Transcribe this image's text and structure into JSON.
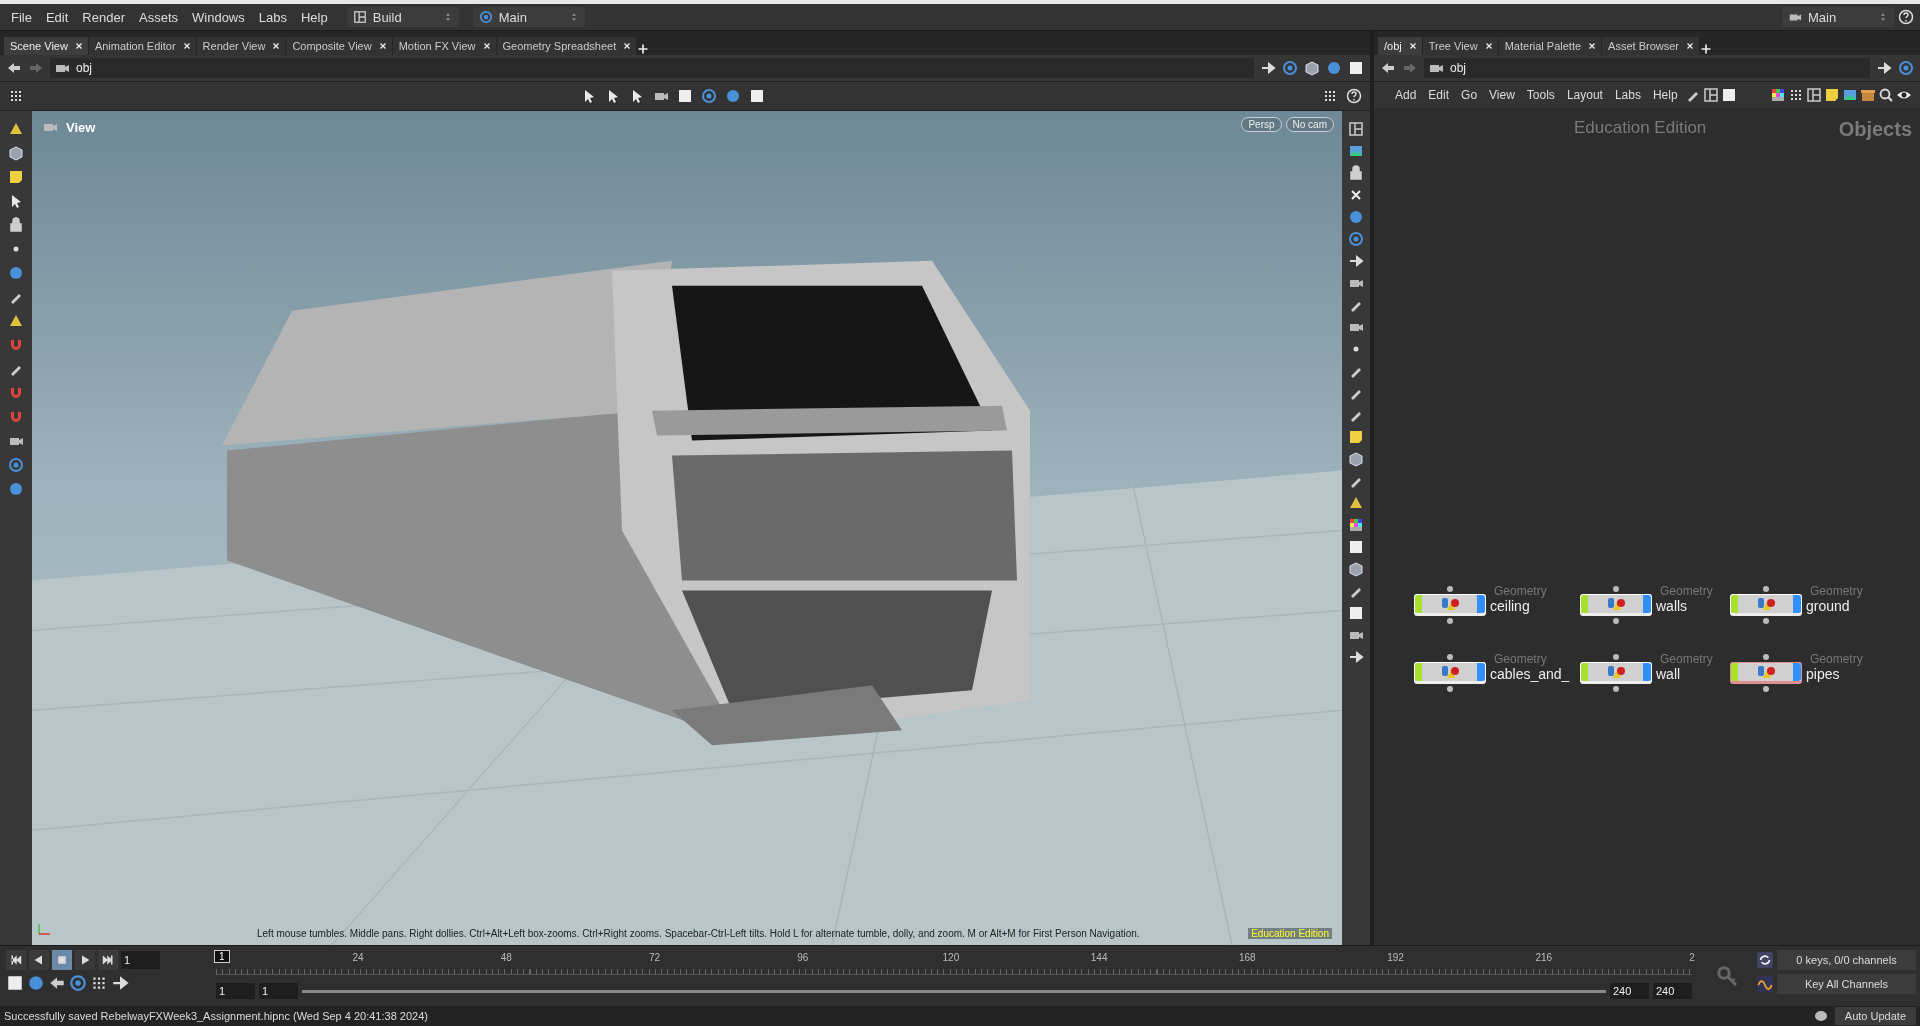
{
  "menu": [
    "File",
    "Edit",
    "Render",
    "Assets",
    "Windows",
    "Labs",
    "Help"
  ],
  "desktop": "Build",
  "update_context": "Main",
  "right_context": "Main",
  "left_pane": {
    "tabs": [
      {
        "label": "Scene View",
        "selected": true
      },
      {
        "label": "Animation Editor",
        "selected": false
      },
      {
        "label": "Render View",
        "selected": false
      },
      {
        "label": "Composite View",
        "selected": false
      },
      {
        "label": "Motion FX View",
        "selected": false
      },
      {
        "label": "Geometry Spreadsheet",
        "selected": false
      }
    ],
    "path": "obj",
    "viewport": {
      "title": "View",
      "camera_buttons": [
        "Persp",
        "No cam"
      ],
      "hint": "Left mouse tumbles. Middle pans. Right dollies. Ctrl+Alt+Left box-zooms. Ctrl+Right zooms. Spacebar-Ctrl-Left tilts. Hold L for alternate tumble, dolly, and zoom. M or Alt+M for First Person Navigation.",
      "watermark": "Education Edition"
    }
  },
  "right_pane": {
    "tabs": [
      {
        "label": "/obj",
        "selected": true
      },
      {
        "label": "Tree View",
        "selected": false
      },
      {
        "label": "Material Palette",
        "selected": false
      },
      {
        "label": "Asset Browser",
        "selected": false
      }
    ],
    "path": "obj",
    "menu": [
      "Add",
      "Edit",
      "Go",
      "View",
      "Tools",
      "Layout",
      "Labs",
      "Help"
    ],
    "network": {
      "edition": "Education Edition",
      "context": "Objects",
      "nodes": [
        {
          "type": "Geometry",
          "name": "ceiling",
          "selected": false
        },
        {
          "type": "Geometry",
          "name": "walls",
          "selected": false
        },
        {
          "type": "Geometry",
          "name": "ground",
          "selected": false
        },
        {
          "type": "Geometry",
          "name": "cables_and_",
          "selected": false
        },
        {
          "type": "Geometry",
          "name": "wall",
          "selected": false
        },
        {
          "type": "Geometry",
          "name": "pipes",
          "selected": true
        }
      ]
    }
  },
  "timeline": {
    "current_frame": "1",
    "frame_marker": "1",
    "ticks": [
      "24",
      "48",
      "72",
      "96",
      "120",
      "144",
      "168",
      "192",
      "216",
      "2"
    ],
    "range_start": "1",
    "playback_start": "1",
    "playback_end": "240",
    "range_end": "240",
    "range": {
      "level": 1
    },
    "keys": "0 keys, 0/0 channels",
    "key_mode": "Key All Channels"
  },
  "status": {
    "message": "Successfully saved RebelwayFXWeek3_Assignment.hipnc (Wed Sep  4 20:41:38 2024)",
    "update_mode": "Auto Update"
  }
}
